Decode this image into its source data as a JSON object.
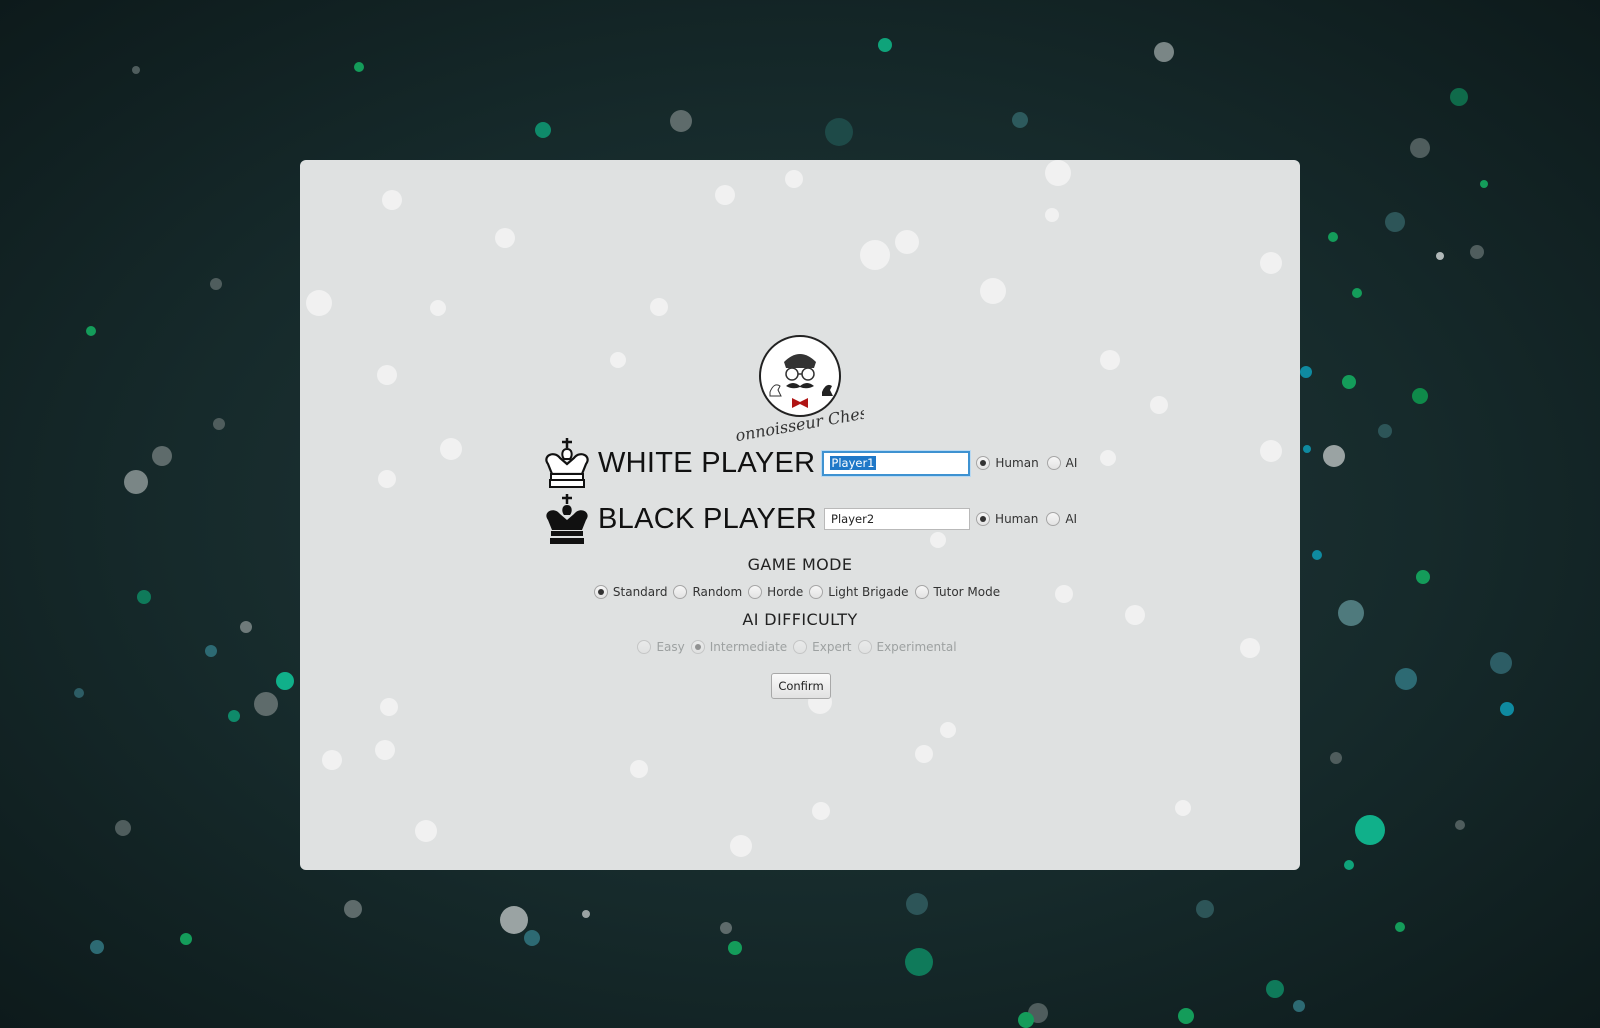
{
  "logo": {
    "text": "Connoisseur Chess"
  },
  "white": {
    "label": "WHITE PLAYER",
    "name_value": "Player1",
    "options": [
      {
        "label": "Human",
        "checked": true
      },
      {
        "label": "AI",
        "checked": false
      }
    ]
  },
  "black": {
    "label": "BLACK PLAYER",
    "name_value": "Player2",
    "options": [
      {
        "label": "Human",
        "checked": true
      },
      {
        "label": "AI",
        "checked": false
      }
    ]
  },
  "game_mode": {
    "title": "GAME MODE",
    "options": [
      {
        "label": "Standard",
        "checked": true
      },
      {
        "label": "Random",
        "checked": false
      },
      {
        "label": "Horde",
        "checked": false
      },
      {
        "label": "Light Brigade",
        "checked": false
      },
      {
        "label": "Tutor Mode",
        "checked": false
      }
    ]
  },
  "ai_difficulty": {
    "title": "AI DIFFICULTY",
    "disabled": true,
    "options": [
      {
        "label": "Easy",
        "checked": false
      },
      {
        "label": "Intermediate",
        "checked": true
      },
      {
        "label": "Expert",
        "checked": false
      },
      {
        "label": "Experimental",
        "checked": false
      }
    ]
  },
  "confirm_label": "Confirm",
  "colors": {
    "accent": "#1f78c8",
    "particle_green": "#0fa37a",
    "background": "#162a2b"
  }
}
